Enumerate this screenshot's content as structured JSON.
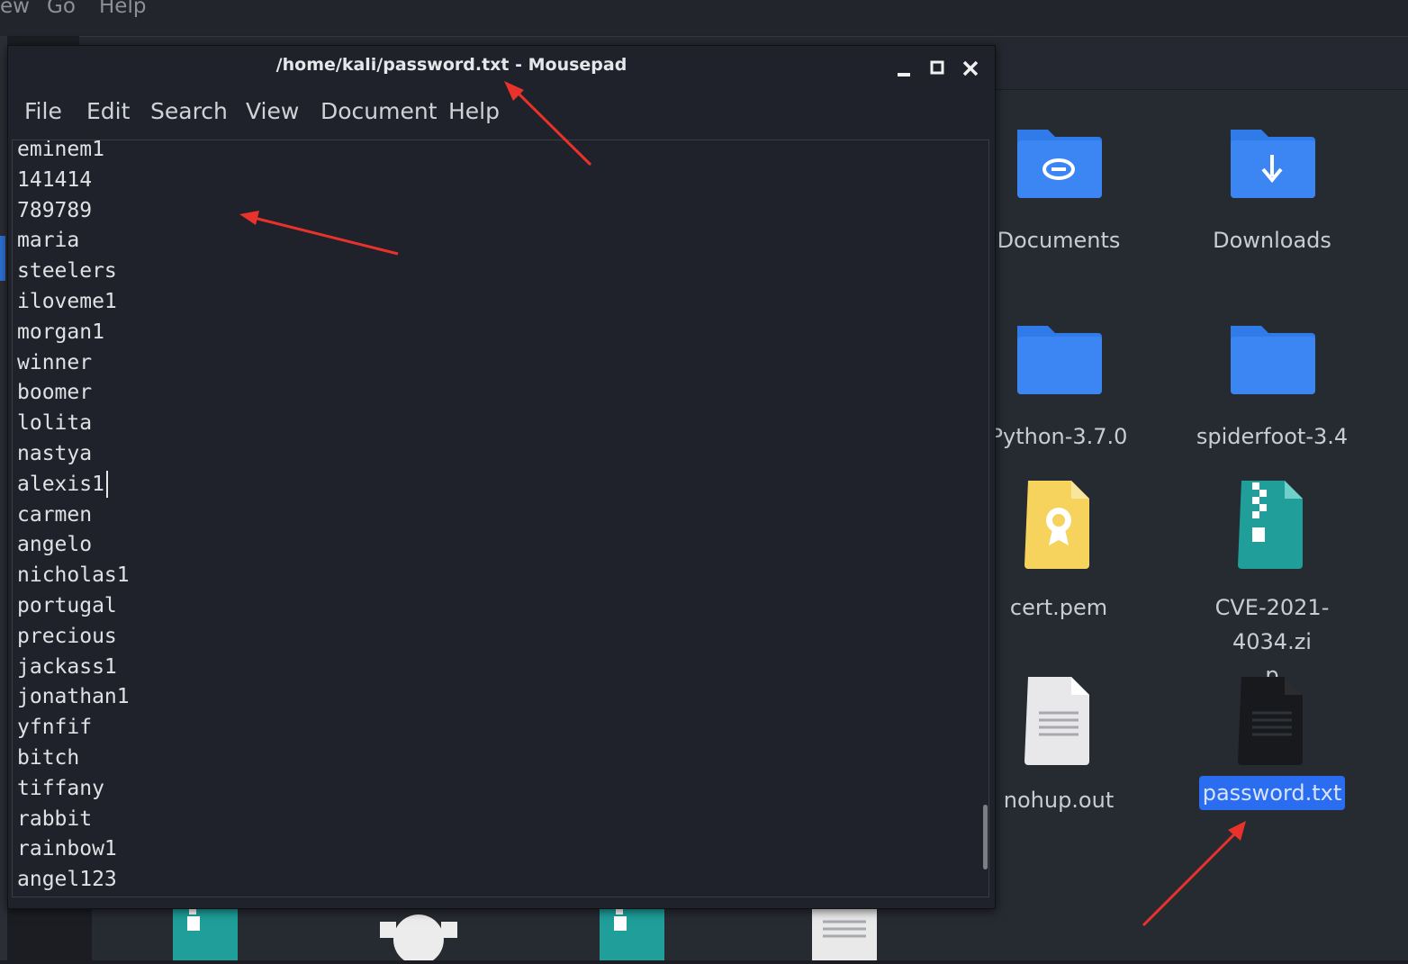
{
  "background_menubar": {
    "items": [
      "ew",
      "Go",
      "Help"
    ]
  },
  "file_manager": {
    "items": [
      {
        "label": "Documents",
        "icon": "folder-documents-icon",
        "selected": false
      },
      {
        "label": "Downloads",
        "icon": "folder-downloads-icon",
        "selected": false
      },
      {
        "label": "Python-3.7.0",
        "icon": "folder-icon",
        "selected": false
      },
      {
        "label": "spiderfoot-3.4",
        "icon": "folder-icon",
        "selected": false
      },
      {
        "label": "cert.pem",
        "icon": "certificate-file-icon",
        "selected": false
      },
      {
        "label_line1": "CVE-2021-4034.zi",
        "label_line2": "p",
        "icon": "zip-archive-icon",
        "selected": false
      },
      {
        "label": "nohup.out",
        "icon": "text-file-icon",
        "selected": false
      },
      {
        "label": "password.txt",
        "icon": "dark-text-file-icon",
        "selected": true
      }
    ]
  },
  "mousepad": {
    "title": "/home/kali/password.txt - Mousepad",
    "menu": [
      "File",
      "Edit",
      "Search",
      "View",
      "Document",
      "Help"
    ],
    "lines": [
      "eminem1",
      "141414",
      "789789",
      "maria",
      "steelers",
      "iloveme1",
      "morgan1",
      "winner",
      "boomer",
      "lolita",
      "nastya",
      "alexis1",
      "carmen",
      "angelo",
      "nicholas1",
      "portugal",
      "precious",
      "jackass1",
      "jonathan1",
      "yfnfif",
      "bitch",
      "tiffany",
      "rabbit",
      "rainbow1",
      "angel123"
    ],
    "caret_line_index": 11
  },
  "colors": {
    "selection": "#2a6df0",
    "folder": "#2f7bea",
    "annotation_arrow": "#e8322b"
  }
}
